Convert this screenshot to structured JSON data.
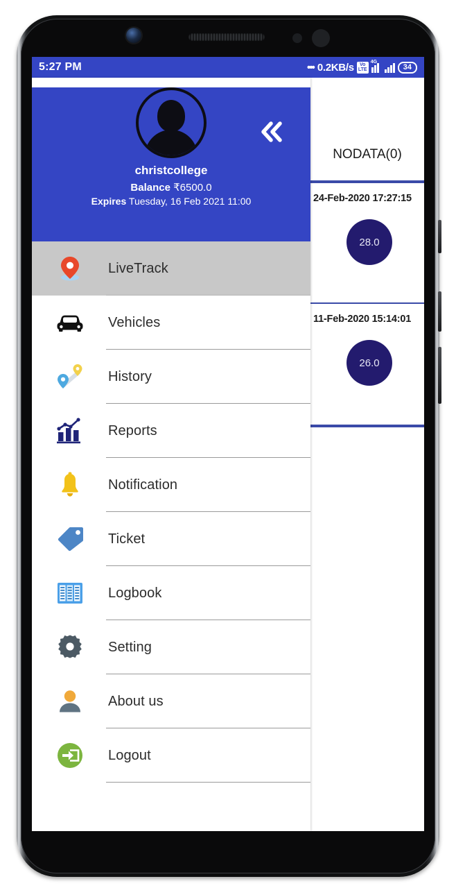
{
  "status_bar": {
    "time": "5:27 PM",
    "dots": "•••",
    "net_speed": "0.2KB/s",
    "volte_top": "Vo",
    "volte_bottom": "LTE",
    "network_generation": "4G",
    "battery_level": "34"
  },
  "drawer": {
    "avatar_icon": "user-avatar-icon",
    "collapse_icon": "double-chevron-left-icon",
    "account_name": "christcollege",
    "balance_label": "Balance",
    "balance_value": "₹6500.0",
    "expires_label": "Expires",
    "expires_value": "Tuesday, 16 Feb 2021 11:00",
    "header_color": "#3445c4",
    "active_row_color": "#c8c8c8",
    "items": [
      {
        "label": "LiveTrack",
        "icon": "map-pin-icon",
        "active": true
      },
      {
        "label": "Vehicles",
        "icon": "car-icon",
        "active": false
      },
      {
        "label": "History",
        "icon": "route-pins-icon",
        "active": false
      },
      {
        "label": "Reports",
        "icon": "bar-chart-icon",
        "active": false
      },
      {
        "label": "Notification",
        "icon": "bell-icon",
        "active": false
      },
      {
        "label": "Ticket",
        "icon": "tag-icon",
        "active": false
      },
      {
        "label": "Logbook",
        "icon": "logbook-icon",
        "active": false
      },
      {
        "label": "Setting",
        "icon": "gear-icon",
        "active": false
      },
      {
        "label": "About us",
        "icon": "person-icon",
        "active": false
      },
      {
        "label": "Logout",
        "icon": "logout-arrow-icon",
        "active": false
      }
    ]
  },
  "panel": {
    "nodata_label": "NODATA(0)",
    "bubble_color": "#231b6e",
    "card_border_color": "#3a4aa8",
    "cards": [
      {
        "date": "24-Feb-2020 17:27:15",
        "value": "28.0"
      },
      {
        "date": "11-Feb-2020 15:14:01",
        "value": "26.0"
      }
    ]
  }
}
